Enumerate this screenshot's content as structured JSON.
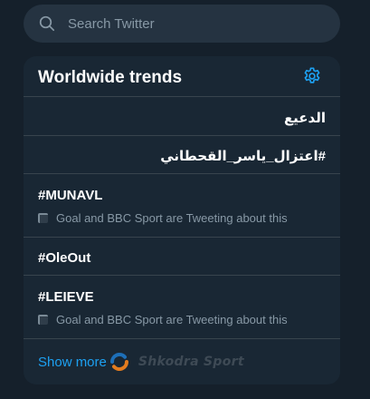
{
  "search": {
    "placeholder": "Search Twitter",
    "icon": "search-icon"
  },
  "trends_panel": {
    "title": "Worldwide trends",
    "settings_icon": "gear-icon",
    "accent_color": "#1da1f2",
    "items": [
      {
        "name": "الدعيع",
        "direction": "rtl"
      },
      {
        "name": "#اعتزال_ياسر_القحطاني",
        "direction": "rtl"
      },
      {
        "name": "#MUNAVL",
        "context": "Goal and BBC Sport are Tweeting about this"
      },
      {
        "name": "#OleOut"
      },
      {
        "name": "#LEIEVE",
        "context": "Goal and BBC Sport are Tweeting about this"
      }
    ],
    "show_more": "Show more"
  },
  "watermark": {
    "text": "Shkodra Sport"
  }
}
